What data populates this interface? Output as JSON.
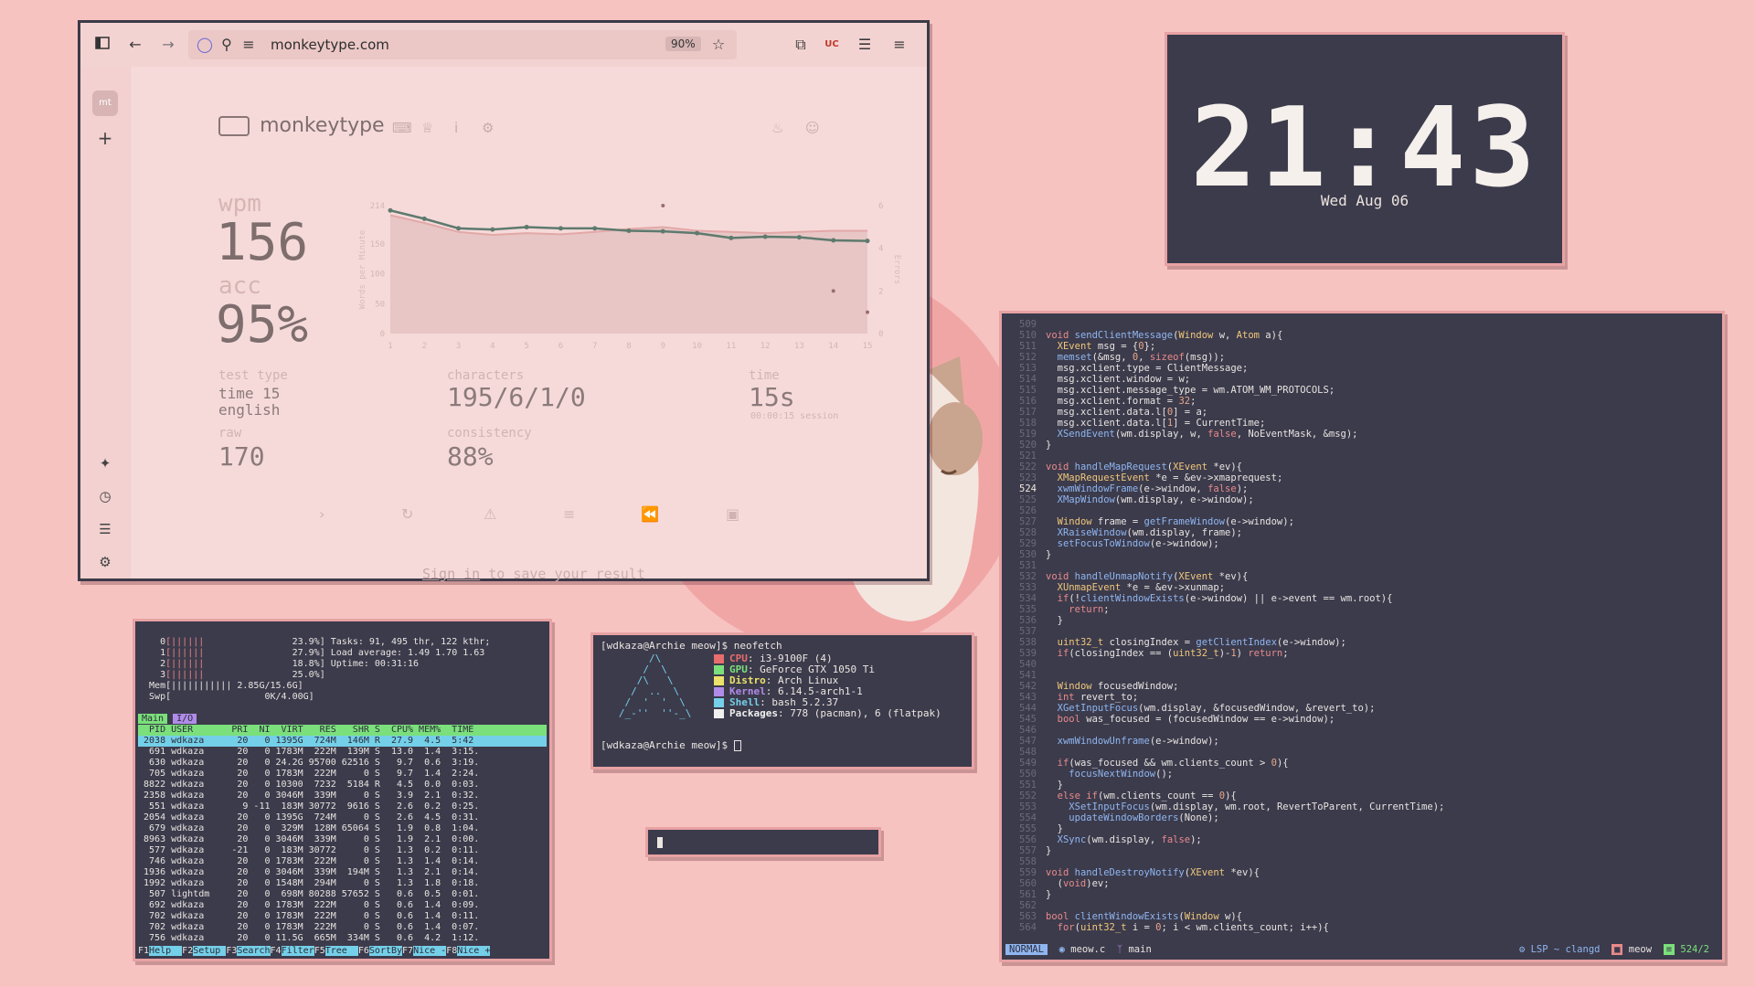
{
  "browser": {
    "url": "monkeytype.com",
    "zoom": "90%",
    "sidebar_logo": "mt",
    "sidebar_add": "+",
    "site_name": "monkeytype",
    "results": {
      "wpm_label": "wpm",
      "wpm_value": "156",
      "acc_label": "acc",
      "acc_value": "95%",
      "test_type_label": "test type",
      "test_type_line1": "time 15",
      "test_type_line2": "english",
      "raw_label": "raw",
      "raw_value": "170",
      "characters_label": "characters",
      "characters_value": "195/6/1/0",
      "consistency_label": "consistency",
      "consistency_value": "88%",
      "time_label": "time",
      "time_value": "15s",
      "session": "00:00:15 session"
    },
    "sign_in_link": "Sign in",
    "sign_in_rest": " to save your result"
  },
  "chart_data": {
    "type": "line",
    "x": [
      1,
      2,
      3,
      4,
      5,
      6,
      7,
      8,
      9,
      10,
      11,
      12,
      13,
      14,
      15
    ],
    "series": [
      {
        "name": "wpm",
        "values": [
          206,
          192,
          176,
          174,
          178,
          176,
          176,
          172,
          171,
          168,
          160,
          162,
          161,
          156,
          155
        ]
      },
      {
        "name": "raw",
        "values": [
          198,
          185,
          170,
          165,
          168,
          166,
          170,
          175,
          178,
          172,
          170,
          168,
          170,
          172,
          172
        ]
      }
    ],
    "errors_x": [
      9,
      14,
      15
    ],
    "errors_y": [
      6,
      2,
      1
    ],
    "ylabel": "Words per Minute",
    "y2label": "Errors",
    "yticks": [
      "214",
      "150",
      "100",
      "50",
      "0"
    ],
    "y2ticks": [
      "6",
      "4",
      "2",
      "0"
    ],
    "xticks": [
      "1",
      "2",
      "3",
      "4",
      "5",
      "6",
      "7",
      "8",
      "9",
      "10",
      "11",
      "12",
      "13",
      "14",
      "15"
    ],
    "ylim": [
      0,
      214
    ],
    "y2lim": [
      0,
      6
    ],
    "colors": {
      "wpm": "#5e7a6e",
      "raw": "#e3a8a8",
      "fill": "#e7c6c5",
      "errors": "#9a6e6e"
    }
  },
  "clock": {
    "time": "21:43",
    "date": "Wed Aug 06"
  },
  "htop": {
    "cpus": [
      {
        "id": "0",
        "bar": "[||||||",
        "pct": "23.9%]"
      },
      {
        "id": "1",
        "bar": "[||||||",
        "pct": "27.9%]"
      },
      {
        "id": "2",
        "bar": "[||||||",
        "pct": "18.8%]"
      },
      {
        "id": "3",
        "bar": "[||||||",
        "pct": "25.0%]"
      }
    ],
    "mem": "Mem[||||||||||| 2.85G/15.6G]",
    "swp": "Swp[                 0K/4.00G]",
    "tasks": "Tasks: 91, 495 thr, 122 kthr;",
    "load": "Load average: 1.49 1.70 1.63",
    "uptime": "Uptime: 00:31:16",
    "tabs": [
      "Main",
      "I/O"
    ],
    "header": "  PID USER       PRI  NI  VIRT   RES   SHR S  CPU% MEM%  TIME",
    "rows": [
      " 2038 wdkaza      20   0 1395G  724M  146M R  27.9  4.5  5:42",
      "  691 wdkaza      20   0 1783M  222M  139M S  13.0  1.4  3:15.",
      "  630 wdkaza      20   0 24.2G 95700 62516 S   9.7  0.6  3:19.",
      "  705 wdkaza      20   0 1783M  222M     0 S   9.7  1.4  2:24.",
      " 8822 wdkaza      20   0 10300  7232  5184 R   4.5  0.0  0:03.",
      " 2358 wdkaza      20   0 3046M  339M     0 S   3.9  2.1  0:32.",
      "  551 wdkaza       9 -11  183M 30772  9616 S   2.6  0.2  0:25.",
      " 2054 wdkaza      20   0 1395G  724M     0 S   2.6  4.5  0:31.",
      "  679 wdkaza      20   0  329M  128M 65064 S   1.9  0.8  1:04.",
      " 8963 wdkaza      20   0 3046M  339M     0 S   1.9  2.1  0:00.",
      "  577 wdkaza     -21   0  183M 30772     0 S   1.3  0.2  0:11.",
      "  746 wdkaza      20   0 1783M  222M     0 S   1.3  1.4  0:14.",
      " 1936 wdkaza      20   0 3046M  339M  194M S   1.3  2.1  0:14.",
      " 1992 wdkaza      20   0 1548M  294M     0 S   1.3  1.8  0:18.",
      "  507 lightdm     20   0  698M 80288 57652 S   0.6  0.5  0:01.",
      "  692 wdkaza      20   0 1783M  222M     0 S   0.6  1.4  0:09.",
      "  702 wdkaza      20   0 1783M  222M     0 S   0.6  1.4  0:11.",
      "  702 wdkaza      20   0 1783M  222M     0 S   0.6  1.4  0:07.",
      "  756 wdkaza      20   0 11.5G  665M  334M S   0.6  4.2  1:12."
    ],
    "fkeys": [
      {
        "k": "F1",
        "v": "Help  "
      },
      {
        "k": "F2",
        "v": "Setup "
      },
      {
        "k": "F3",
        "v": "Search"
      },
      {
        "k": "F4",
        "v": "Filter"
      },
      {
        "k": "F5",
        "v": "Tree  "
      },
      {
        "k": "F6",
        "v": "SortBy"
      },
      {
        "k": "F7",
        "v": "Nice -"
      },
      {
        "k": "F8",
        "v": "Nice +"
      }
    ]
  },
  "neofetch": {
    "prompt1": "[wdkaza@Archie meow]$ neofetch",
    "logo": [
      "        /\\",
      "       /  \\",
      "      /\\   \\",
      "     /  ..  \\",
      "    /  '  '  \\",
      "   /_-''  ''-_\\"
    ],
    "info": [
      {
        "k": "CPU",
        "v": ": i3-9100F (4)",
        "c": "#e86d6d"
      },
      {
        "k": "GPU",
        "v": ": GeForce GTX 1050 Ti",
        "c": "#7be07b"
      },
      {
        "k": "Distro",
        "v": ": Arch Linux",
        "c": "#ece26b"
      },
      {
        "k": "Kernel",
        "v": ": 6.14.5-arch1-1",
        "c": "#b08be8"
      },
      {
        "k": "Shell",
        "v": ": bash 5.2.37",
        "c": "#74d0e8"
      },
      {
        "k": "Packages",
        "v": ": 778 (pacman), 6 (flatpak)",
        "c": "#f0f0f0"
      }
    ],
    "prompt2": "[wdkaza@Archie meow]$ "
  },
  "editor": {
    "lines": [
      [
        "509",
        ""
      ],
      [
        "510",
        "void sendClientMessage(Window w, Atom a){"
      ],
      [
        "511",
        "  XEvent msg = {0};"
      ],
      [
        "512",
        "  memset(&msg, 0, sizeof(msg));"
      ],
      [
        "513",
        "  msg.xclient.type = ClientMessage;"
      ],
      [
        "514",
        "  msg.xclient.window = w;"
      ],
      [
        "515",
        "  msg.xclient.message_type = wm.ATOM_WM_PROTOCOLS;"
      ],
      [
        "516",
        "  msg.xclient.format = 32;"
      ],
      [
        "517",
        "  msg.xclient.data.l[0] = a;"
      ],
      [
        "518",
        "  msg.xclient.data.l[1] = CurrentTime;"
      ],
      [
        "519",
        "  XSendEvent(wm.display, w, false, NoEventMask, &msg);"
      ],
      [
        "520",
        "}"
      ],
      [
        "521",
        ""
      ],
      [
        "522",
        "void handleMapRequest(XEvent *ev){"
      ],
      [
        "523",
        "  XMapRequestEvent *e = &ev->xmaprequest;"
      ],
      [
        "524",
        "  xwmWindowFrame(e->window, false);"
      ],
      [
        "525",
        "  XMapWindow(wm.display, e->window);"
      ],
      [
        "526",
        ""
      ],
      [
        "527",
        "  Window frame = getFrameWindow(e->window);"
      ],
      [
        "528",
        "  XRaiseWindow(wm.display, frame);"
      ],
      [
        "529",
        "  setFocusToWindow(e->window);"
      ],
      [
        "530",
        "}"
      ],
      [
        "531",
        ""
      ],
      [
        "532",
        "void handleUnmapNotify(XEvent *ev){"
      ],
      [
        "533",
        "  XUnmapEvent *e = &ev->xunmap;"
      ],
      [
        "534",
        "  if(!clientWindowExists(e->window) || e->event == wm.root){"
      ],
      [
        "535",
        "    return;"
      ],
      [
        "536",
        "  }"
      ],
      [
        "537",
        ""
      ],
      [
        "538",
        "  uint32_t closingIndex = getClientIndex(e->window);"
      ],
      [
        "539",
        "  if(closingIndex == (uint32_t)-1) return;"
      ],
      [
        "540",
        ""
      ],
      [
        "541",
        ""
      ],
      [
        "542",
        "  Window focusedWindow;"
      ],
      [
        "543",
        "  int revert_to;"
      ],
      [
        "544",
        "  XGetInputFocus(wm.display, &focusedWindow, &revert_to);"
      ],
      [
        "545",
        "  bool was_focused = (focusedWindow == e->window);"
      ],
      [
        "546",
        ""
      ],
      [
        "547",
        "  xwmWindowUnframe(e->window);"
      ],
      [
        "548",
        ""
      ],
      [
        "549",
        "  if(was_focused && wm.clients_count > 0){"
      ],
      [
        "550",
        "    focusNextWindow();"
      ],
      [
        "551",
        "  }"
      ],
      [
        "552",
        "  else if(wm.clients_count == 0){"
      ],
      [
        "553",
        "    XSetInputFocus(wm.display, wm.root, RevertToParent, CurrentTime);"
      ],
      [
        "554",
        "    updateWindowBorders(None);"
      ],
      [
        "555",
        "  }"
      ],
      [
        "556",
        "  XSync(wm.display, false);"
      ],
      [
        "557",
        "}"
      ],
      [
        "558",
        ""
      ],
      [
        "559",
        "void handleDestroyNotify(XEvent *ev){"
      ],
      [
        "560",
        "  (void)ev;"
      ],
      [
        "561",
        "}"
      ],
      [
        "562",
        ""
      ],
      [
        "563",
        "bool clientWindowExists(Window w){"
      ],
      [
        "564",
        "  for(uint32_t i = 0; i < wm.clients_count; i++){"
      ]
    ],
    "status_mode": "NORMAL",
    "status_file": "meow.c",
    "status_branch": "main",
    "status_lsp": "LSP ~ clangd",
    "status_dir": "meow",
    "status_pos": "524/2"
  }
}
